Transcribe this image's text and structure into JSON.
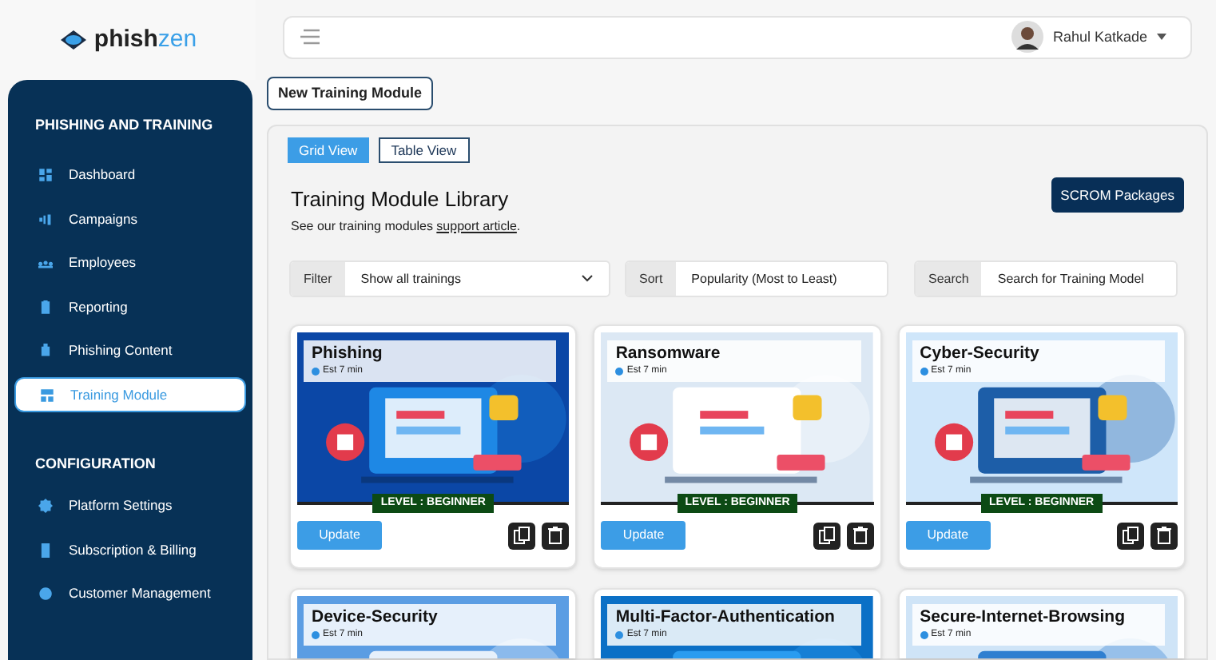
{
  "logo": {
    "text_dark": "phish",
    "text_accent": "zen"
  },
  "user": {
    "name": "Rahul Katkade"
  },
  "sidebar": {
    "sections": [
      {
        "title": "PHISHING AND TRAINING",
        "items": [
          {
            "label": "Dashboard",
            "selected": false
          },
          {
            "label": "Campaigns",
            "selected": false
          },
          {
            "label": "Employees",
            "selected": false
          },
          {
            "label": "Reporting",
            "selected": false
          },
          {
            "label": "Phishing Content",
            "selected": false
          },
          {
            "label": "Training Module",
            "selected": true
          }
        ]
      },
      {
        "title": "CONFIGURATION",
        "items": [
          {
            "label": "Platform Settings",
            "selected": false
          },
          {
            "label": "Subscription & Billing",
            "selected": false
          },
          {
            "label": "Customer Management",
            "selected": false
          }
        ]
      }
    ]
  },
  "new_button": "New Training Module",
  "view_tabs": [
    {
      "label": "Grid View",
      "selected": true
    },
    {
      "label": "Table View",
      "selected": false
    }
  ],
  "library": {
    "title": "Training Module Library",
    "subtitle_before": "See our training modules ",
    "link": "support article",
    "subtitle_after": ".",
    "scorm_button": "SCROM Packages"
  },
  "filters": [
    {
      "label": "Filter",
      "value": "Show all trainings",
      "dropdown": true
    },
    {
      "label": "Sort",
      "value": "Popularity (Most to Least)",
      "dropdown": false
    },
    {
      "label": "Search",
      "placeholder": "Search for Training Model",
      "dropdown": false
    }
  ],
  "cards": [
    {
      "title": "Phishing",
      "duration": "Est 7 min",
      "level": "LEVEL : BEGINNER",
      "update": "Update"
    },
    {
      "title": "Ransomware",
      "duration": "Est 7 min",
      "level": "LEVEL : BEGINNER",
      "update": "Update"
    },
    {
      "title": "Cyber-Security",
      "duration": "Est 7 min",
      "level": "LEVEL : BEGINNER",
      "update": "Update"
    },
    {
      "title": "Device-Security",
      "duration": "Est 7 min"
    },
    {
      "title": "Multi-Factor-Authentication",
      "duration": "Est 7 min"
    },
    {
      "title": "Secure-Internet-Browsing",
      "duration": "Est 7 min"
    }
  ]
}
